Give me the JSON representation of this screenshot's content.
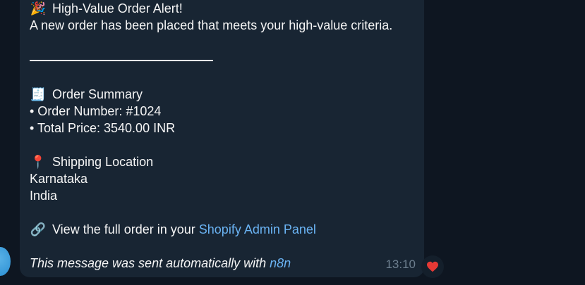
{
  "message": {
    "title_emoji": "🎉",
    "title": "High-Value Order Alert!",
    "intro": "A new order has been placed that meets your high-value criteria.",
    "summary_emoji": "🧾",
    "summary_heading": "Order Summary",
    "order_number": "• Order Number: #1024",
    "total_price": "• Total Price: 3540.00 INR",
    "shipping_emoji": "📍",
    "shipping_heading": "Shipping Location",
    "state": "Karnataka",
    "country": "India",
    "link_emoji": "🔗",
    "view_text": "View the full order in your ",
    "admin_link": "Shopify Admin Panel",
    "footer_text": "This message was sent automatically with ",
    "footer_link": "n8n",
    "time": "13:10"
  },
  "reaction": {
    "icon": "heart-icon",
    "color": "#e53935"
  }
}
